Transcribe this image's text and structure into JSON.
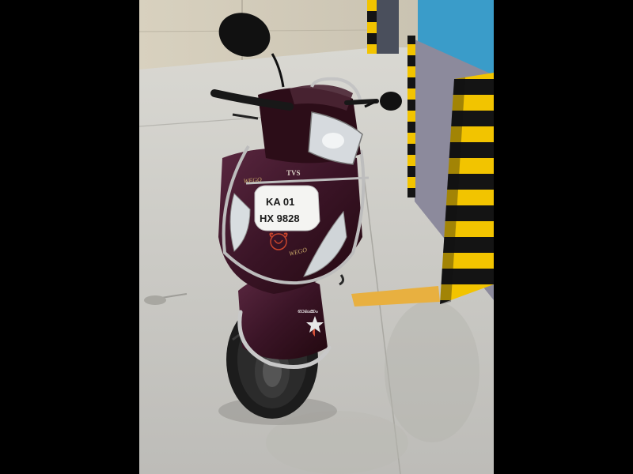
{
  "scene": {
    "subject": "scooter",
    "setting": "parking-garage"
  },
  "scooter": {
    "brand": "TVS",
    "model_badge": "WEGO",
    "plate_line1": "KA  01",
    "plate_line2": "HX  9828",
    "sticker_text": "ഓലക്കം",
    "body_color": "#3a1426"
  },
  "colors": {
    "letterbox": "#000000",
    "floor": "#cfcfcb",
    "wall_blue": "#3a9cc9",
    "wall_grey": "#8c8a9c",
    "hazard_yellow": "#f2c400",
    "hazard_black": "#141414",
    "floor_marking": "#e8b040"
  }
}
